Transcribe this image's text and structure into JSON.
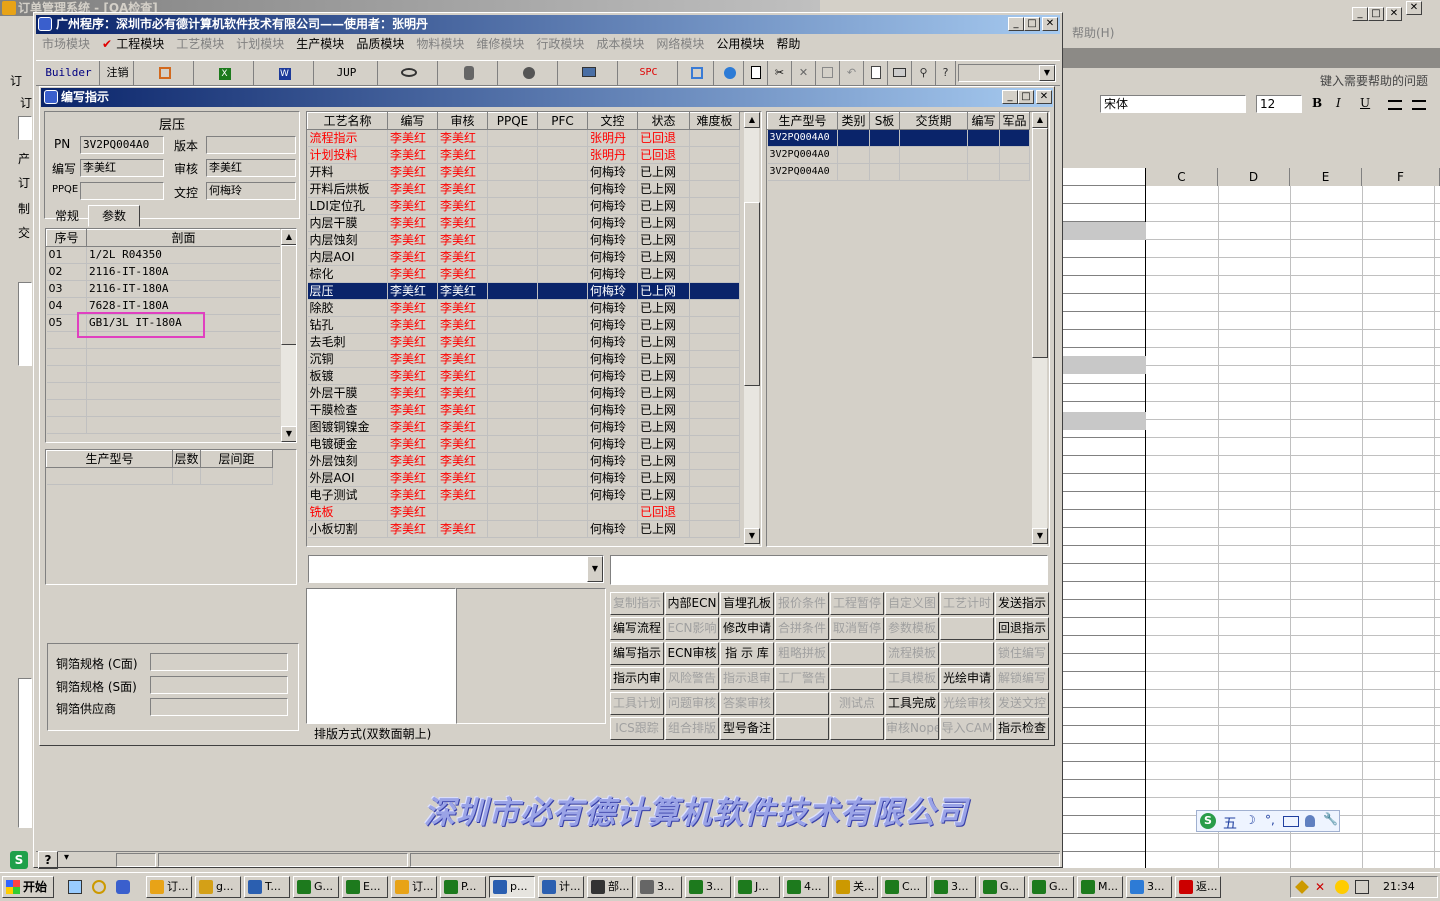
{
  "background": {
    "outer_title": "订单管理系统 - [QA检查]",
    "excel": {
      "help_menu": "帮助(H)",
      "help_input_placeholder": "键入需要帮助的问题",
      "font_name": "宋体",
      "font_size": "12",
      "bold": "B",
      "italic": "I",
      "underline": "U",
      "columns": [
        "C",
        "D",
        "E",
        "F"
      ]
    },
    "left_strip_labels": [
      "订",
      "订",
      "产",
      "订",
      "制",
      "交"
    ]
  },
  "main_window": {
    "title": "广州程序：深圳市必有德计算机软件技术有限公司——使用者：张明丹",
    "menu": [
      {
        "label": "市场模块",
        "dim": true
      },
      {
        "label": "工程模块",
        "dim": false,
        "checked": true
      },
      {
        "label": "工艺模块",
        "dim": true
      },
      {
        "label": "计划模块",
        "dim": true
      },
      {
        "label": "生产模块",
        "dim": false
      },
      {
        "label": "品质模块",
        "dim": false
      },
      {
        "label": "物料模块",
        "dim": true
      },
      {
        "label": "维修模块",
        "dim": true
      },
      {
        "label": "行政模块",
        "dim": true
      },
      {
        "label": "成本模块",
        "dim": true
      },
      {
        "label": "网络模块",
        "dim": true
      },
      {
        "label": "公用模块",
        "dim": false
      },
      {
        "label": "帮助",
        "dim": false
      }
    ],
    "toolbar": {
      "builder": "Builder",
      "logout": "注销",
      "jup": "JUP",
      "spc": "SPC"
    },
    "company_banner": "深圳市必有德计算机软件技术有限公司"
  },
  "dialog": {
    "title": "编写指示",
    "group_title": "层压",
    "fields": {
      "pn_label": "PN",
      "pn_value": "3V2PQ004A0",
      "version_label": "版本",
      "version_value": "",
      "writer_label": "编写",
      "writer_value": "李美红",
      "reviewer_label": "审核",
      "reviewer_value": "李美红",
      "ppqe_label": "PPQE",
      "ppqe_value": "",
      "doc_label": "文控",
      "doc_value": "何梅玲"
    },
    "tabs": [
      "常规",
      "参数"
    ],
    "layer_table": {
      "headers": [
        "序号",
        "剖面"
      ],
      "rows": [
        [
          "01",
          "1/2L R04350"
        ],
        [
          "02",
          "2116-IT-180A"
        ],
        [
          "03",
          "2116-IT-180A"
        ],
        [
          "04",
          "7628-IT-180A"
        ],
        [
          "05",
          "GB1/3L IT-180A"
        ]
      ]
    },
    "model_table": {
      "headers": [
        "生产型号",
        "层数",
        "层间距"
      ]
    },
    "copper": {
      "c_side": "铜箔规格 (C面)",
      "s_side": "铜箔规格 (S面)",
      "supplier": "铜箔供应商"
    },
    "process_table": {
      "headers": [
        "工艺名称",
        "编写",
        "审核",
        "PPQE",
        "PFC",
        "文控",
        "状态",
        "难度板"
      ],
      "rows": [
        {
          "name": "流程指示",
          "writer": "李美红",
          "reviewer": "李美红",
          "doc": "张明丹",
          "status": "已回退",
          "red": true
        },
        {
          "name": "计划投料",
          "writer": "李美红",
          "reviewer": "李美红",
          "doc": "张明丹",
          "status": "已回退",
          "red": true
        },
        {
          "name": "开料",
          "writer": "李美红",
          "reviewer": "李美红",
          "doc": "何梅玲",
          "status": "已上网"
        },
        {
          "name": "开料后烘板",
          "writer": "李美红",
          "reviewer": "李美红",
          "doc": "何梅玲",
          "status": "已上网"
        },
        {
          "name": "LDI定位孔",
          "writer": "李美红",
          "reviewer": "李美红",
          "doc": "何梅玲",
          "status": "已上网"
        },
        {
          "name": "内层干膜",
          "writer": "李美红",
          "reviewer": "李美红",
          "doc": "何梅玲",
          "status": "已上网"
        },
        {
          "name": "内层蚀刻",
          "writer": "李美红",
          "reviewer": "李美红",
          "doc": "何梅玲",
          "status": "已上网"
        },
        {
          "name": "内层AOI",
          "writer": "李美红",
          "reviewer": "李美红",
          "doc": "何梅玲",
          "status": "已上网"
        },
        {
          "name": "棕化",
          "writer": "李美红",
          "reviewer": "李美红",
          "doc": "何梅玲",
          "status": "已上网"
        },
        {
          "name": "层压",
          "writer": "李美红",
          "reviewer": "李美红",
          "doc": "何梅玲",
          "status": "已上网",
          "selected": true
        },
        {
          "name": "除胶",
          "writer": "李美红",
          "reviewer": "李美红",
          "doc": "何梅玲",
          "status": "已上网"
        },
        {
          "name": "钻孔",
          "writer": "李美红",
          "reviewer": "李美红",
          "doc": "何梅玲",
          "status": "已上网"
        },
        {
          "name": "去毛刺",
          "writer": "李美红",
          "reviewer": "李美红",
          "doc": "何梅玲",
          "status": "已上网"
        },
        {
          "name": "沉铜",
          "writer": "李美红",
          "reviewer": "李美红",
          "doc": "何梅玲",
          "status": "已上网"
        },
        {
          "name": "板镀",
          "writer": "李美红",
          "reviewer": "李美红",
          "doc": "何梅玲",
          "status": "已上网"
        },
        {
          "name": "外层干膜",
          "writer": "李美红",
          "reviewer": "李美红",
          "doc": "何梅玲",
          "status": "已上网"
        },
        {
          "name": "干膜检查",
          "writer": "李美红",
          "reviewer": "李美红",
          "doc": "何梅玲",
          "status": "已上网"
        },
        {
          "name": "图镀铜镍金",
          "writer": "李美红",
          "reviewer": "李美红",
          "doc": "何梅玲",
          "status": "已上网"
        },
        {
          "name": "电镀硬金",
          "writer": "李美红",
          "reviewer": "李美红",
          "doc": "何梅玲",
          "status": "已上网"
        },
        {
          "name": "外层蚀刻",
          "writer": "李美红",
          "reviewer": "李美红",
          "doc": "何梅玲",
          "status": "已上网"
        },
        {
          "name": "外层AOI",
          "writer": "李美红",
          "reviewer": "李美红",
          "doc": "何梅玲",
          "status": "已上网"
        },
        {
          "name": "电子测试",
          "writer": "李美红",
          "reviewer": "李美红",
          "doc": "何梅玲",
          "status": "已上网"
        },
        {
          "name": "铣板",
          "writer": "李美红",
          "reviewer": "",
          "doc": "",
          "status": "已回退",
          "red": true
        },
        {
          "name": "小板切割",
          "writer": "李美红",
          "reviewer": "李美红",
          "doc": "何梅玲",
          "status": "已上网"
        }
      ]
    },
    "right_table": {
      "headers": [
        "生产型号",
        "类别",
        "S板",
        "交货期",
        "编写",
        "军品"
      ],
      "rows": [
        "3V2PQ004A0",
        "3V2PQ004A0",
        "3V2PQ004A0"
      ]
    },
    "layout_label": "排版方式(双数面朝上)",
    "buttons": [
      [
        {
          "l": "复制指示",
          "d": true
        },
        {
          "l": "内部ECN",
          "d": false
        },
        {
          "l": "盲埋孔板",
          "d": false
        },
        {
          "l": "报价条件",
          "d": true
        },
        {
          "l": "工程暂停",
          "d": true
        },
        {
          "l": "自定义图",
          "d": true
        },
        {
          "l": "工艺计时",
          "d": true
        },
        {
          "l": "发送指示",
          "d": false
        }
      ],
      [
        {
          "l": "编写流程",
          "d": false
        },
        {
          "l": "ECN影响",
          "d": true
        },
        {
          "l": "修改申请",
          "d": false
        },
        {
          "l": "合拼条件",
          "d": true
        },
        {
          "l": "取消暂停",
          "d": true
        },
        {
          "l": "参数模板",
          "d": true
        },
        {
          "l": "",
          "d": true
        },
        {
          "l": "回退指示",
          "d": false
        }
      ],
      [
        {
          "l": "编写指示",
          "d": false
        },
        {
          "l": "ECN审核",
          "d": false
        },
        {
          "l": "指 示 库",
          "d": false
        },
        {
          "l": "粗略拼板",
          "d": true
        },
        {
          "l": "",
          "d": true
        },
        {
          "l": "流程模板",
          "d": true
        },
        {
          "l": "",
          "d": true
        },
        {
          "l": "锁住编写",
          "d": true
        }
      ],
      [
        {
          "l": "指示内审",
          "d": false
        },
        {
          "l": "风险警告",
          "d": true
        },
        {
          "l": "指示退审",
          "d": true
        },
        {
          "l": "工厂警告",
          "d": true
        },
        {
          "l": "",
          "d": true
        },
        {
          "l": "工具模板",
          "d": true
        },
        {
          "l": "光绘申请",
          "d": false
        },
        {
          "l": "解锁编写",
          "d": true
        }
      ],
      [
        {
          "l": "工具计划",
          "d": true
        },
        {
          "l": "问题审核",
          "d": true
        },
        {
          "l": "答案审核",
          "d": true
        },
        {
          "l": "",
          "d": true
        },
        {
          "l": "测试点",
          "d": true
        },
        {
          "l": "工具完成",
          "d": false
        },
        {
          "l": "光绘审核",
          "d": true
        },
        {
          "l": "发送文控",
          "d": true
        }
      ],
      [
        {
          "l": "ICS跟踪",
          "d": true
        },
        {
          "l": "组合排版",
          "d": true
        },
        {
          "l": "型号备注",
          "d": false
        },
        {
          "l": "",
          "d": true
        },
        {
          "l": "",
          "d": true
        },
        {
          "l": "审核Nope",
          "d": true
        },
        {
          "l": "导入CAM",
          "d": true
        },
        {
          "l": "指示检查",
          "d": false
        }
      ]
    ]
  },
  "taskbar": {
    "start": "开始",
    "clock": "21:34",
    "items": [
      "订...",
      "g...",
      "T...",
      "G...",
      "E...",
      "订...",
      "P...",
      "p...",
      "计...",
      "部...",
      "3...",
      "3...",
      "J...",
      "4...",
      "关...",
      "C...",
      "3...",
      "G...",
      "G...",
      "M...",
      "3...",
      "返..."
    ]
  },
  "ime": {
    "mode": "五"
  }
}
